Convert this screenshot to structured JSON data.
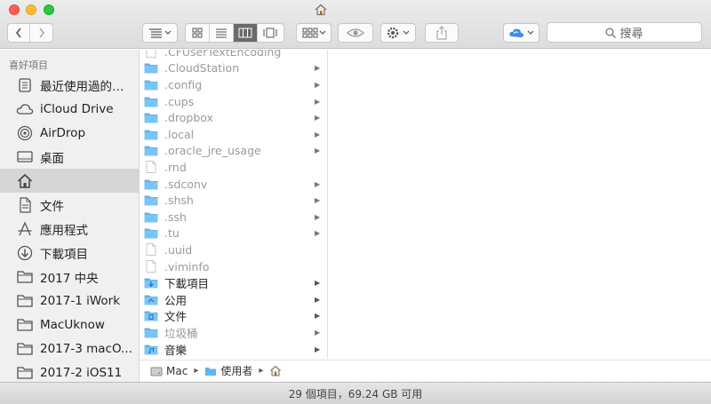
{
  "toolbar": {
    "search_placeholder": "搜尋"
  },
  "sidebar": {
    "header": "喜好項目",
    "items": [
      {
        "label": "最近使用過的…",
        "icon": "recents-icon"
      },
      {
        "label": "iCloud Drive",
        "icon": "cloud-icon"
      },
      {
        "label": "AirDrop",
        "icon": "airdrop-icon"
      },
      {
        "label": "桌面",
        "icon": "desktop-icon"
      },
      {
        "label": "",
        "icon": "home-icon",
        "selected": true
      },
      {
        "label": "文件",
        "icon": "documents-icon"
      },
      {
        "label": "應用程式",
        "icon": "applications-icon"
      },
      {
        "label": "下載項目",
        "icon": "downloads-icon"
      },
      {
        "label": "2017 中央",
        "icon": "folder-icon"
      },
      {
        "label": "2017-1 iWork",
        "icon": "folder-icon"
      },
      {
        "label": "MacUknow",
        "icon": "folder-icon"
      },
      {
        "label": "2017-3 macO...",
        "icon": "folder-icon"
      },
      {
        "label": "2017-2 iOS11",
        "icon": "folder-icon"
      }
    ]
  },
  "column": {
    "rows": [
      {
        "label": ".CFUserTextEncoding",
        "type": "file",
        "hidden": true,
        "arrow": false
      },
      {
        "label": ".CloudStation",
        "type": "folder",
        "hidden": true,
        "arrow": true
      },
      {
        "label": ".config",
        "type": "folder",
        "hidden": true,
        "arrow": true
      },
      {
        "label": ".cups",
        "type": "folder",
        "hidden": true,
        "arrow": true
      },
      {
        "label": ".dropbox",
        "type": "folder",
        "hidden": true,
        "arrow": true
      },
      {
        "label": ".local",
        "type": "folder",
        "hidden": true,
        "arrow": true
      },
      {
        "label": ".oracle_jre_usage",
        "type": "folder",
        "hidden": true,
        "arrow": true
      },
      {
        "label": ".rnd",
        "type": "file",
        "hidden": true,
        "arrow": false
      },
      {
        "label": ".sdconv",
        "type": "folder",
        "hidden": true,
        "arrow": true
      },
      {
        "label": ".shsh",
        "type": "folder",
        "hidden": true,
        "arrow": true
      },
      {
        "label": ".ssh",
        "type": "folder",
        "hidden": true,
        "arrow": true
      },
      {
        "label": ".tu",
        "type": "folder",
        "hidden": true,
        "arrow": true
      },
      {
        "label": ".uuid",
        "type": "file",
        "hidden": true,
        "arrow": false
      },
      {
        "label": ".viminfo",
        "type": "file",
        "hidden": true,
        "arrow": false
      },
      {
        "label": "下載項目",
        "type": "downloads",
        "hidden": false,
        "arrow": true
      },
      {
        "label": "公用",
        "type": "public",
        "hidden": false,
        "arrow": true
      },
      {
        "label": "文件",
        "type": "documents",
        "hidden": false,
        "arrow": true
      },
      {
        "label": "垃圾桶",
        "type": "folder",
        "hidden": true,
        "arrow": true
      },
      {
        "label": "音樂",
        "type": "music",
        "hidden": false,
        "arrow": true
      }
    ]
  },
  "pathbar": {
    "items": [
      "Mac",
      "使用者",
      ""
    ]
  },
  "status": {
    "text": "29 個項目，69.24 GB 可用"
  },
  "colors": {
    "folder": "#5fb4f0",
    "selected_view": "#6b6b6b",
    "sidebar_bg": "#f0f0f0"
  }
}
